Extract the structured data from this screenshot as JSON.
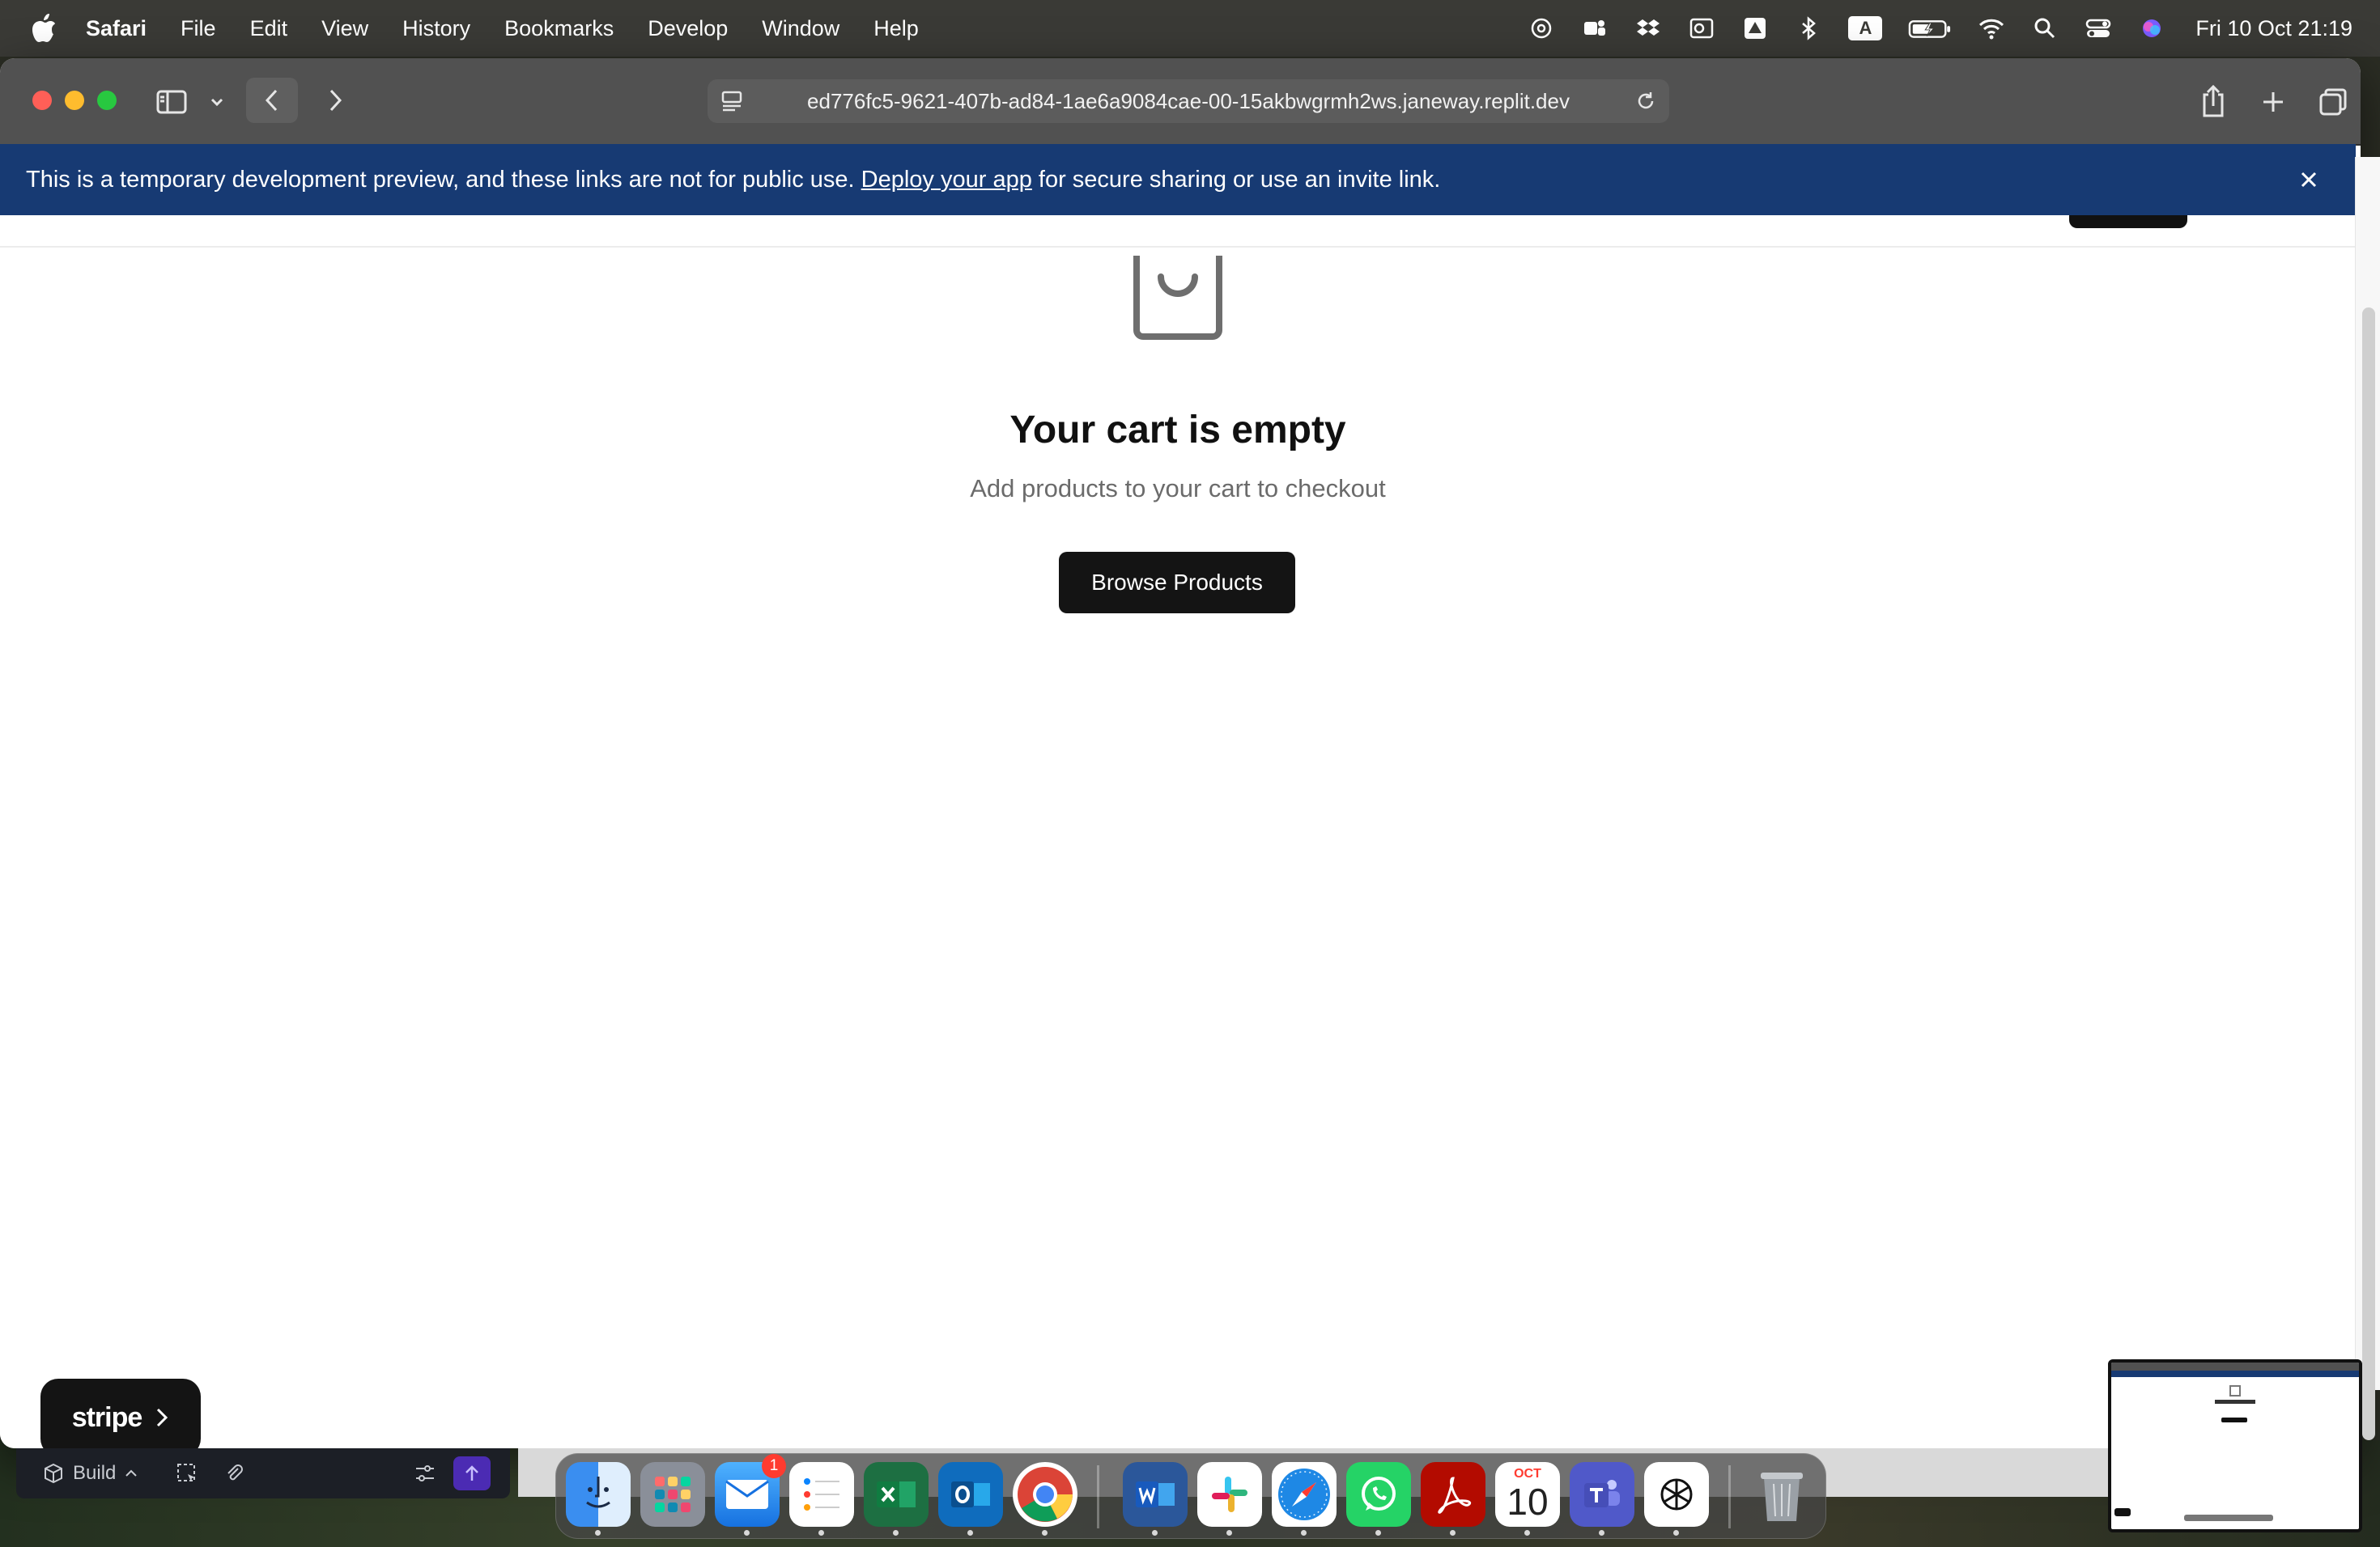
{
  "menubar": {
    "app_name": "Safari",
    "menus": [
      "File",
      "Edit",
      "View",
      "History",
      "Bookmarks",
      "Develop",
      "Window",
      "Help"
    ],
    "clock": "Fri 10 Oct  21:19",
    "input_source": "A"
  },
  "browser": {
    "url": "ed776fc5-9621-407b-ad84-1ae6a9084cae-00-15akbwgrmh2ws.janeway.replit.dev"
  },
  "banner": {
    "text_before": "This is a temporary development preview, and these links are not for public use. ",
    "link": "Deploy your app",
    "text_after": " for secure sharing or use an invite link."
  },
  "cart": {
    "title": "Your cart is empty",
    "subtitle": "Add products to your cart to checkout",
    "button": "Browse Products"
  },
  "stripe_badge": {
    "label": "stripe"
  },
  "replit_bar": {
    "mode_label": "Build"
  },
  "dock": {
    "mail_badge": "1",
    "calendar_month": "OCT",
    "calendar_day": "10",
    "apps": [
      "finder-icon",
      "launchpad-icon",
      "mail-icon",
      "reminders-icon",
      "excel-icon",
      "outlook-icon",
      "chrome-icon",
      "word-icon",
      "slack-icon",
      "safari-icon",
      "whatsapp-icon",
      "acrobat-icon",
      "calendar-icon",
      "teams-icon",
      "chatgpt-icon",
      "trash-icon"
    ]
  },
  "colors": {
    "banner_bg": "#173a73",
    "button_bg": "#141414",
    "menubar_bg": "#3a3a36"
  }
}
